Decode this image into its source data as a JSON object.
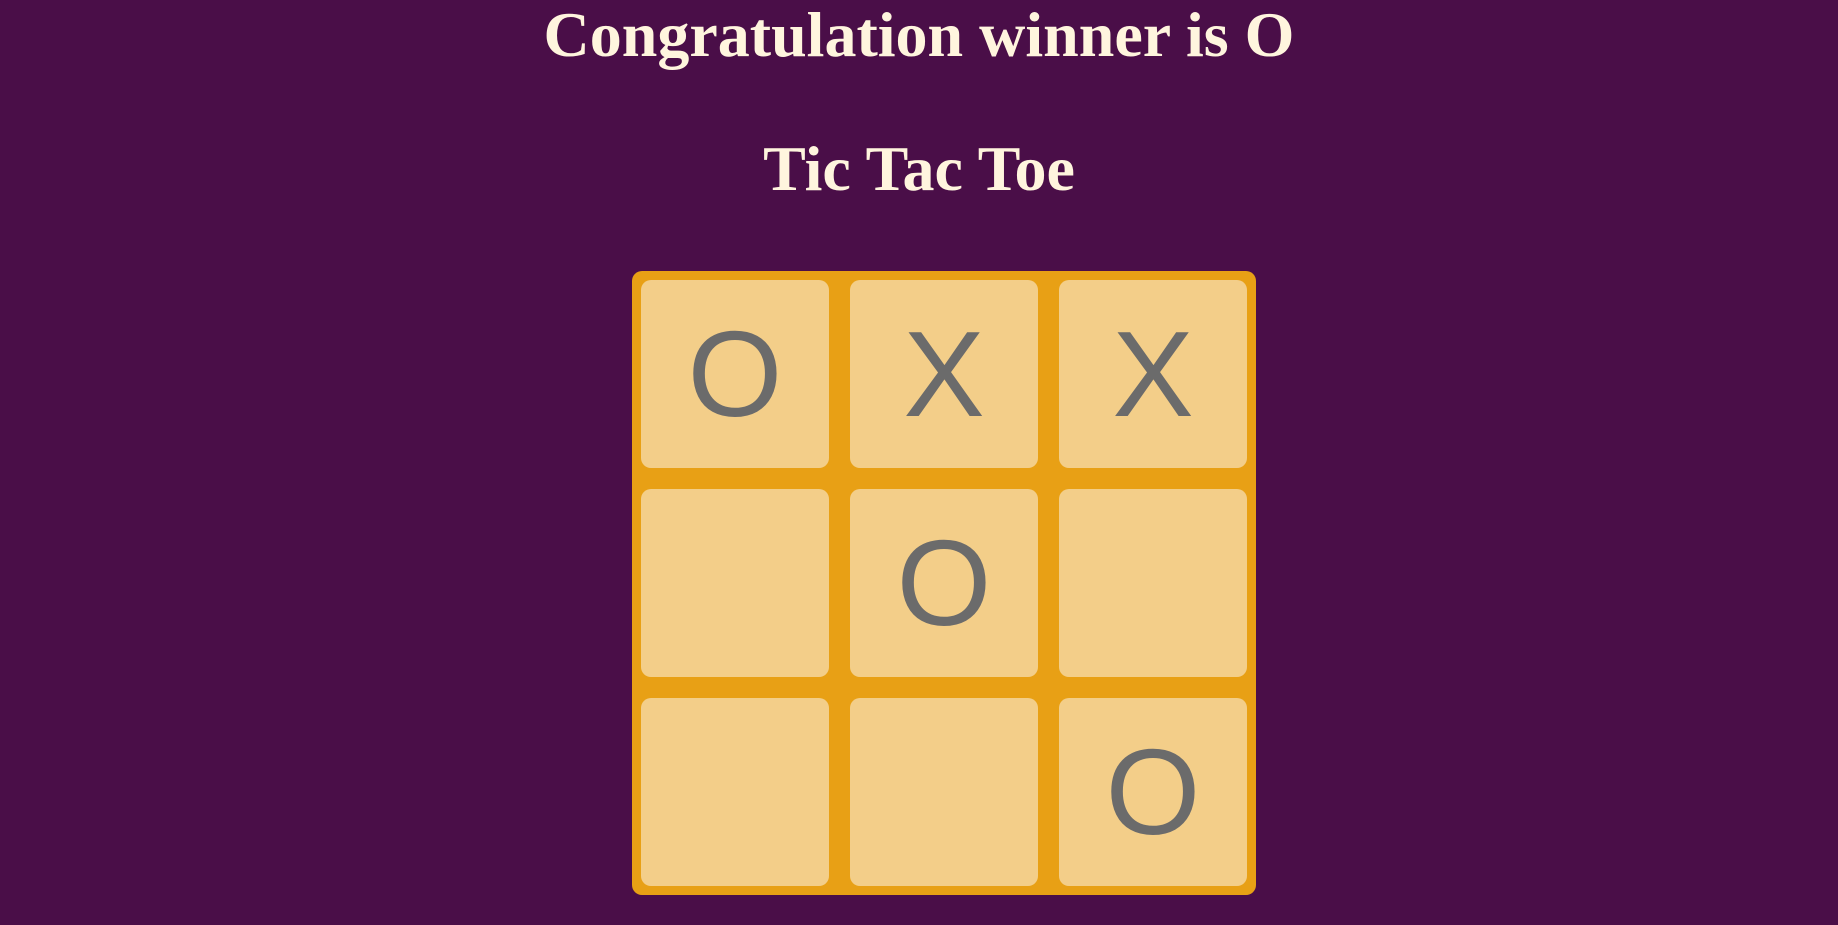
{
  "status": {
    "message": "Congratulation winner is O"
  },
  "game": {
    "title": "Tic Tac Toe"
  },
  "board": {
    "cells": [
      "O",
      "X",
      "X",
      "",
      "O",
      "",
      "",
      "",
      "O"
    ],
    "winner": "O"
  },
  "colors": {
    "background": "#4a0e48",
    "heading_text": "#fff5de",
    "board_frame": "#e8a015",
    "cell_fill": "#f3ce89",
    "mark": "#6b6b6b"
  }
}
